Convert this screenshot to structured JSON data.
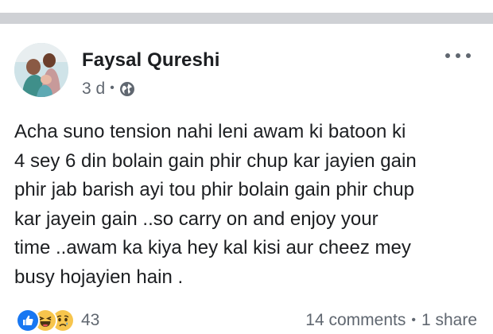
{
  "post": {
    "author": "Faysal Qureshi",
    "time": "3 d",
    "meta_separator": "•",
    "privacy_icon": "globe-icon",
    "more_icon": "more-options-icon",
    "text_lines": [
      "Acha suno tension nahi leni awam ki batoon ki",
      "4 sey 6 din bolain gain phir chup kar jayien gain",
      "phir jab barish ayi tou phir bolain gain phir chup",
      "kar jayein gain ..so carry on and enjoy your",
      "time ..awam ka kiya hey kal kisi aur cheez mey",
      "busy hojayien hain ."
    ]
  },
  "footer": {
    "reactions": [
      "like-reaction-icon",
      "haha-reaction-icon",
      "sad-reaction-icon"
    ],
    "reaction_count": "43",
    "comments": "14 comments",
    "separator": "•",
    "shares": "1 share"
  },
  "colors": {
    "like_blue": "#1877f2",
    "emoji_yellow": "#f7c54d",
    "secondary_text": "#606770",
    "top_bar": "#cfd1d5"
  }
}
